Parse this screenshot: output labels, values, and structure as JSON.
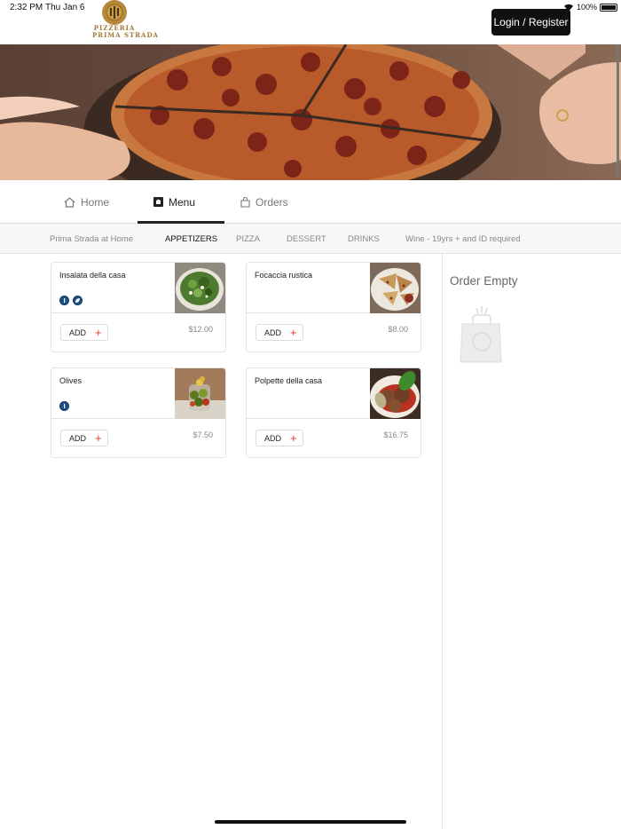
{
  "status_bar": {
    "time": "2:32 PM",
    "date": "Thu Jan 6",
    "battery": "100%"
  },
  "brand": {
    "line1": "PIZZERIA",
    "line2": "PRIMA STRADA"
  },
  "header": {
    "login_label": "Login / Register"
  },
  "nav": {
    "home": "Home",
    "menu": "Menu",
    "orders": "Orders",
    "active": "Menu"
  },
  "categories": {
    "items": [
      "Prima Strada at Home",
      "APPETIZERS",
      "PIZZA",
      "DESSERT",
      "DRINKS",
      "Wine - 19yrs + and ID required"
    ],
    "active": "APPETIZERS"
  },
  "products": [
    {
      "name": "Insalata della casa",
      "price": "$12.00",
      "add_label": "ADD",
      "badges": [
        "info-icon",
        "leaf-icon"
      ]
    },
    {
      "name": "Focaccia rustica",
      "price": "$8.00",
      "add_label": "ADD",
      "badges": []
    },
    {
      "name": "Olives",
      "price": "$7.50",
      "add_label": "ADD",
      "badges": [
        "info-icon"
      ]
    },
    {
      "name": "Polpette della casa",
      "price": "$16.75",
      "add_label": "ADD",
      "badges": []
    }
  ],
  "order": {
    "empty_label": "Order Empty"
  },
  "colors": {
    "accent": "#e23c2f",
    "brand_gold": "#b68a3d",
    "badge_blue": "#1d4f86",
    "dark": "#111111"
  }
}
